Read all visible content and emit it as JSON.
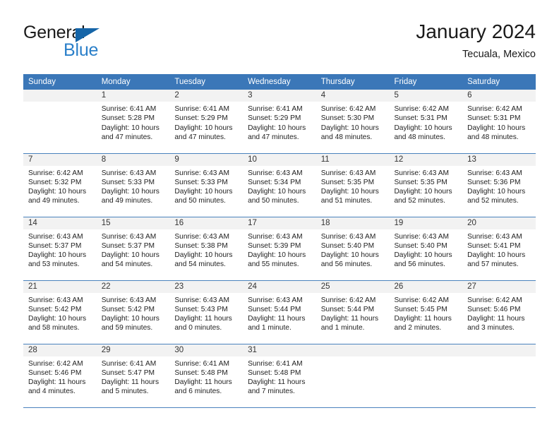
{
  "brand": {
    "word_one": "General",
    "word_two": "Blue",
    "triangle_icon": "triangle-icon",
    "accent_blue": "#2a7fc9",
    "triangle_blue": "#1565a8"
  },
  "header": {
    "title": "January 2024",
    "subtitle": "Tecuala, Mexico"
  },
  "theme": {
    "header_bg": "#3b77b8",
    "daynum_bg": "#f2f2f2",
    "row_border": "#4a82bd"
  },
  "calendar": {
    "weekday_headers": [
      "Sunday",
      "Monday",
      "Tuesday",
      "Wednesday",
      "Thursday",
      "Friday",
      "Saturday"
    ],
    "weeks": [
      [
        {
          "day": "",
          "lines": []
        },
        {
          "day": "1",
          "lines": [
            "Sunrise: 6:41 AM",
            "Sunset: 5:28 PM",
            "Daylight: 10 hours",
            "and 47 minutes."
          ]
        },
        {
          "day": "2",
          "lines": [
            "Sunrise: 6:41 AM",
            "Sunset: 5:29 PM",
            "Daylight: 10 hours",
            "and 47 minutes."
          ]
        },
        {
          "day": "3",
          "lines": [
            "Sunrise: 6:41 AM",
            "Sunset: 5:29 PM",
            "Daylight: 10 hours",
            "and 47 minutes."
          ]
        },
        {
          "day": "4",
          "lines": [
            "Sunrise: 6:42 AM",
            "Sunset: 5:30 PM",
            "Daylight: 10 hours",
            "and 48 minutes."
          ]
        },
        {
          "day": "5",
          "lines": [
            "Sunrise: 6:42 AM",
            "Sunset: 5:31 PM",
            "Daylight: 10 hours",
            "and 48 minutes."
          ]
        },
        {
          "day": "6",
          "lines": [
            "Sunrise: 6:42 AM",
            "Sunset: 5:31 PM",
            "Daylight: 10 hours",
            "and 48 minutes."
          ]
        }
      ],
      [
        {
          "day": "7",
          "lines": [
            "Sunrise: 6:42 AM",
            "Sunset: 5:32 PM",
            "Daylight: 10 hours",
            "and 49 minutes."
          ]
        },
        {
          "day": "8",
          "lines": [
            "Sunrise: 6:43 AM",
            "Sunset: 5:33 PM",
            "Daylight: 10 hours",
            "and 49 minutes."
          ]
        },
        {
          "day": "9",
          "lines": [
            "Sunrise: 6:43 AM",
            "Sunset: 5:33 PM",
            "Daylight: 10 hours",
            "and 50 minutes."
          ]
        },
        {
          "day": "10",
          "lines": [
            "Sunrise: 6:43 AM",
            "Sunset: 5:34 PM",
            "Daylight: 10 hours",
            "and 50 minutes."
          ]
        },
        {
          "day": "11",
          "lines": [
            "Sunrise: 6:43 AM",
            "Sunset: 5:35 PM",
            "Daylight: 10 hours",
            "and 51 minutes."
          ]
        },
        {
          "day": "12",
          "lines": [
            "Sunrise: 6:43 AM",
            "Sunset: 5:35 PM",
            "Daylight: 10 hours",
            "and 52 minutes."
          ]
        },
        {
          "day": "13",
          "lines": [
            "Sunrise: 6:43 AM",
            "Sunset: 5:36 PM",
            "Daylight: 10 hours",
            "and 52 minutes."
          ]
        }
      ],
      [
        {
          "day": "14",
          "lines": [
            "Sunrise: 6:43 AM",
            "Sunset: 5:37 PM",
            "Daylight: 10 hours",
            "and 53 minutes."
          ]
        },
        {
          "day": "15",
          "lines": [
            "Sunrise: 6:43 AM",
            "Sunset: 5:37 PM",
            "Daylight: 10 hours",
            "and 54 minutes."
          ]
        },
        {
          "day": "16",
          "lines": [
            "Sunrise: 6:43 AM",
            "Sunset: 5:38 PM",
            "Daylight: 10 hours",
            "and 54 minutes."
          ]
        },
        {
          "day": "17",
          "lines": [
            "Sunrise: 6:43 AM",
            "Sunset: 5:39 PM",
            "Daylight: 10 hours",
            "and 55 minutes."
          ]
        },
        {
          "day": "18",
          "lines": [
            "Sunrise: 6:43 AM",
            "Sunset: 5:40 PM",
            "Daylight: 10 hours",
            "and 56 minutes."
          ]
        },
        {
          "day": "19",
          "lines": [
            "Sunrise: 6:43 AM",
            "Sunset: 5:40 PM",
            "Daylight: 10 hours",
            "and 56 minutes."
          ]
        },
        {
          "day": "20",
          "lines": [
            "Sunrise: 6:43 AM",
            "Sunset: 5:41 PM",
            "Daylight: 10 hours",
            "and 57 minutes."
          ]
        }
      ],
      [
        {
          "day": "21",
          "lines": [
            "Sunrise: 6:43 AM",
            "Sunset: 5:42 PM",
            "Daylight: 10 hours",
            "and 58 minutes."
          ]
        },
        {
          "day": "22",
          "lines": [
            "Sunrise: 6:43 AM",
            "Sunset: 5:42 PM",
            "Daylight: 10 hours",
            "and 59 minutes."
          ]
        },
        {
          "day": "23",
          "lines": [
            "Sunrise: 6:43 AM",
            "Sunset: 5:43 PM",
            "Daylight: 11 hours",
            "and 0 minutes."
          ]
        },
        {
          "day": "24",
          "lines": [
            "Sunrise: 6:43 AM",
            "Sunset: 5:44 PM",
            "Daylight: 11 hours",
            "and 1 minute."
          ]
        },
        {
          "day": "25",
          "lines": [
            "Sunrise: 6:42 AM",
            "Sunset: 5:44 PM",
            "Daylight: 11 hours",
            "and 1 minute."
          ]
        },
        {
          "day": "26",
          "lines": [
            "Sunrise: 6:42 AM",
            "Sunset: 5:45 PM",
            "Daylight: 11 hours",
            "and 2 minutes."
          ]
        },
        {
          "day": "27",
          "lines": [
            "Sunrise: 6:42 AM",
            "Sunset: 5:46 PM",
            "Daylight: 11 hours",
            "and 3 minutes."
          ]
        }
      ],
      [
        {
          "day": "28",
          "lines": [
            "Sunrise: 6:42 AM",
            "Sunset: 5:46 PM",
            "Daylight: 11 hours",
            "and 4 minutes."
          ]
        },
        {
          "day": "29",
          "lines": [
            "Sunrise: 6:41 AM",
            "Sunset: 5:47 PM",
            "Daylight: 11 hours",
            "and 5 minutes."
          ]
        },
        {
          "day": "30",
          "lines": [
            "Sunrise: 6:41 AM",
            "Sunset: 5:48 PM",
            "Daylight: 11 hours",
            "and 6 minutes."
          ]
        },
        {
          "day": "31",
          "lines": [
            "Sunrise: 6:41 AM",
            "Sunset: 5:48 PM",
            "Daylight: 11 hours",
            "and 7 minutes."
          ]
        },
        {
          "day": "",
          "lines": []
        },
        {
          "day": "",
          "lines": []
        },
        {
          "day": "",
          "lines": []
        }
      ]
    ]
  }
}
